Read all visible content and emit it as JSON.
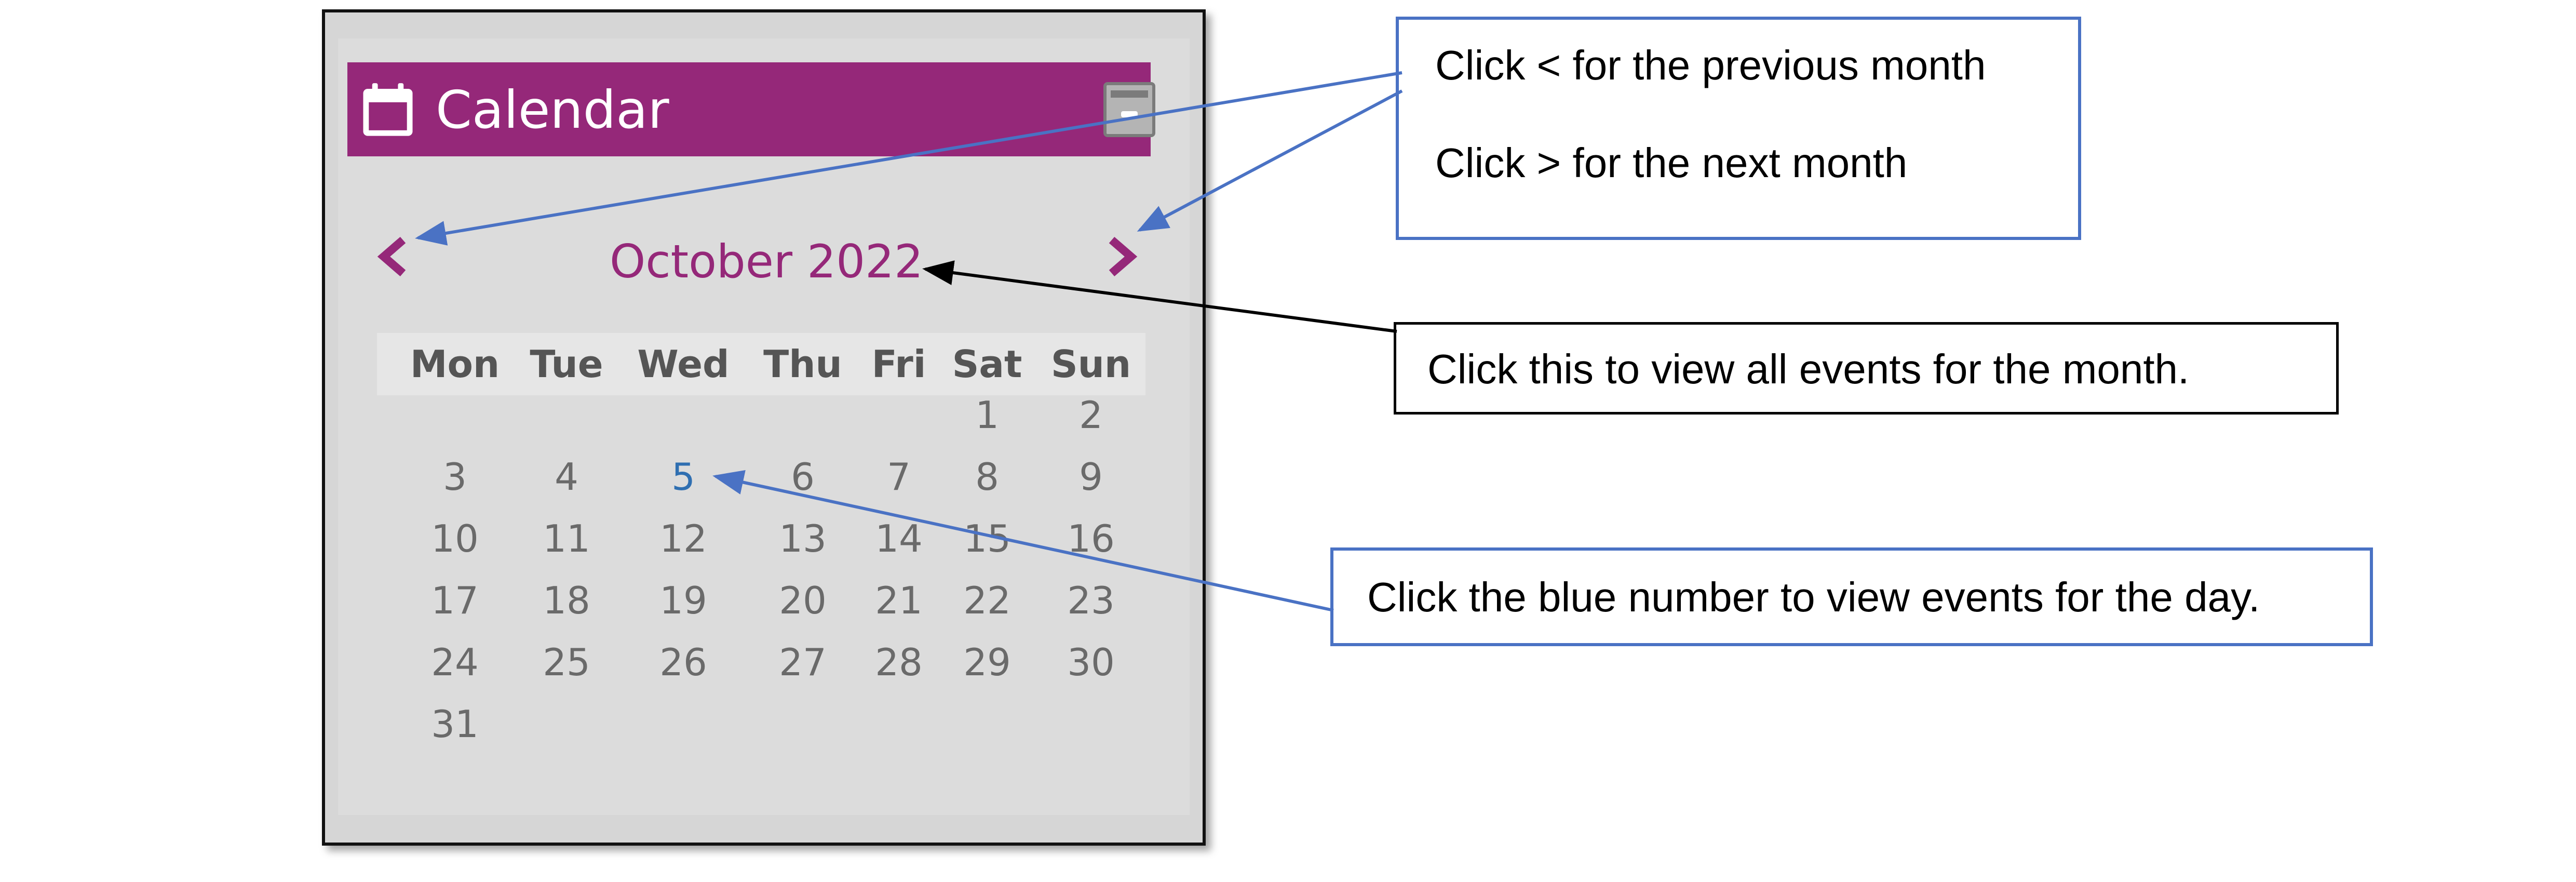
{
  "widget": {
    "title": "Calendar",
    "title_icon": "calendar-icon",
    "collapse_icon": "minimize-icon",
    "prev_icon": "chevron-left-icon",
    "next_icon": "chevron-right-icon",
    "month_label": "October 2022",
    "weekdays": [
      "Mon",
      "Tue",
      "Wed",
      "Thu",
      "Fri",
      "Sat",
      "Sun"
    ],
    "weeks": [
      [
        "",
        "",
        "",
        "",
        "",
        "1",
        "2"
      ],
      [
        "3",
        "4",
        "5",
        "6",
        "7",
        "8",
        "9"
      ],
      [
        "10",
        "11",
        "12",
        "13",
        "14",
        "15",
        "16"
      ],
      [
        "17",
        "18",
        "19",
        "20",
        "21",
        "22",
        "23"
      ],
      [
        "24",
        "25",
        "26",
        "27",
        "28",
        "29",
        "30"
      ],
      [
        "31",
        "",
        "",
        "",
        "",
        "",
        ""
      ]
    ],
    "event_days": [
      "5"
    ]
  },
  "colors": {
    "accent": "#952879",
    "event_day": "#2f6fb1",
    "arrow_blue": "#4a72c4",
    "arrow_black": "#000000"
  },
  "callouts": {
    "month_nav_line1": "Click < for the previous month",
    "month_nav_line2": "Click > for the next month",
    "month_view": "Click this to view all events for the month.",
    "day_view": "Click the blue number to view events for the day."
  }
}
